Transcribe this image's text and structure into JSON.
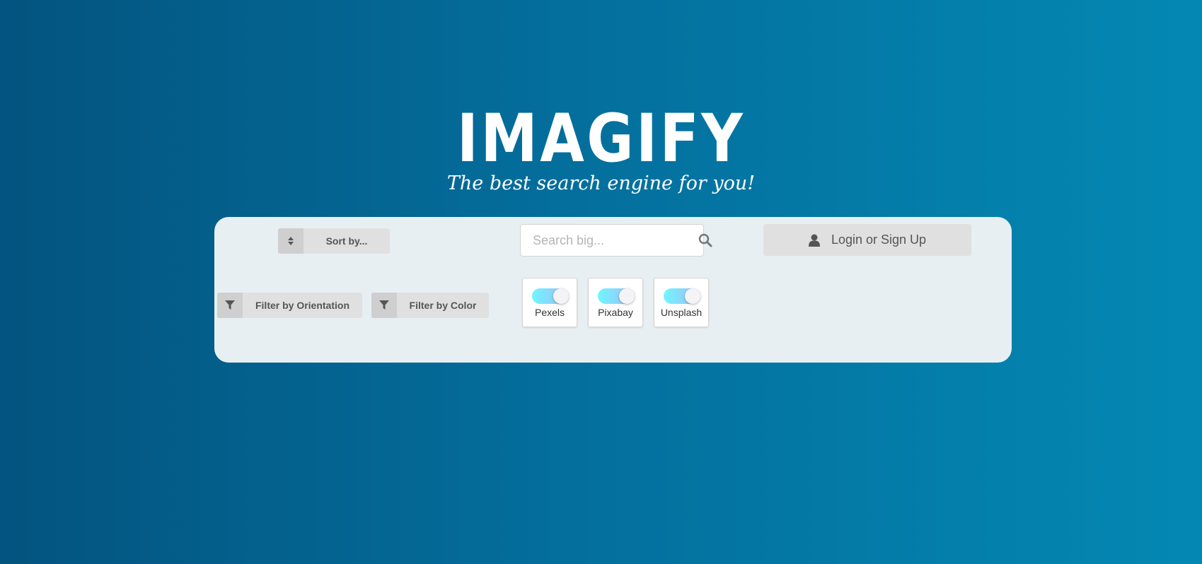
{
  "logo": {
    "title": "IMAGIFY",
    "tagline": "The best search engine for you!"
  },
  "controls": {
    "sort": {
      "label": "Sort by...",
      "icon": "sort-icon"
    },
    "filter_orientation": {
      "label": "Filter by Orientation",
      "icon": "filter-icon"
    },
    "filter_color": {
      "label": "Filter by Color",
      "icon": "filter-icon"
    },
    "search": {
      "placeholder": "Search big...",
      "value": "",
      "icon": "search-icon"
    },
    "login": {
      "label": "Login or Sign Up",
      "icon": "user-icon"
    }
  },
  "sources": [
    {
      "name": "Pexels",
      "enabled": true
    },
    {
      "name": "Pixabay",
      "enabled": true
    },
    {
      "name": "Unsplash",
      "enabled": true
    }
  ],
  "colors": {
    "background_start": "#03547f",
    "background_end": "#0488b3",
    "panel": "#e7eff3",
    "button": "#e0e0e0",
    "toggle_start": "#6ff6ff",
    "toggle_end": "#a5b9f7"
  }
}
